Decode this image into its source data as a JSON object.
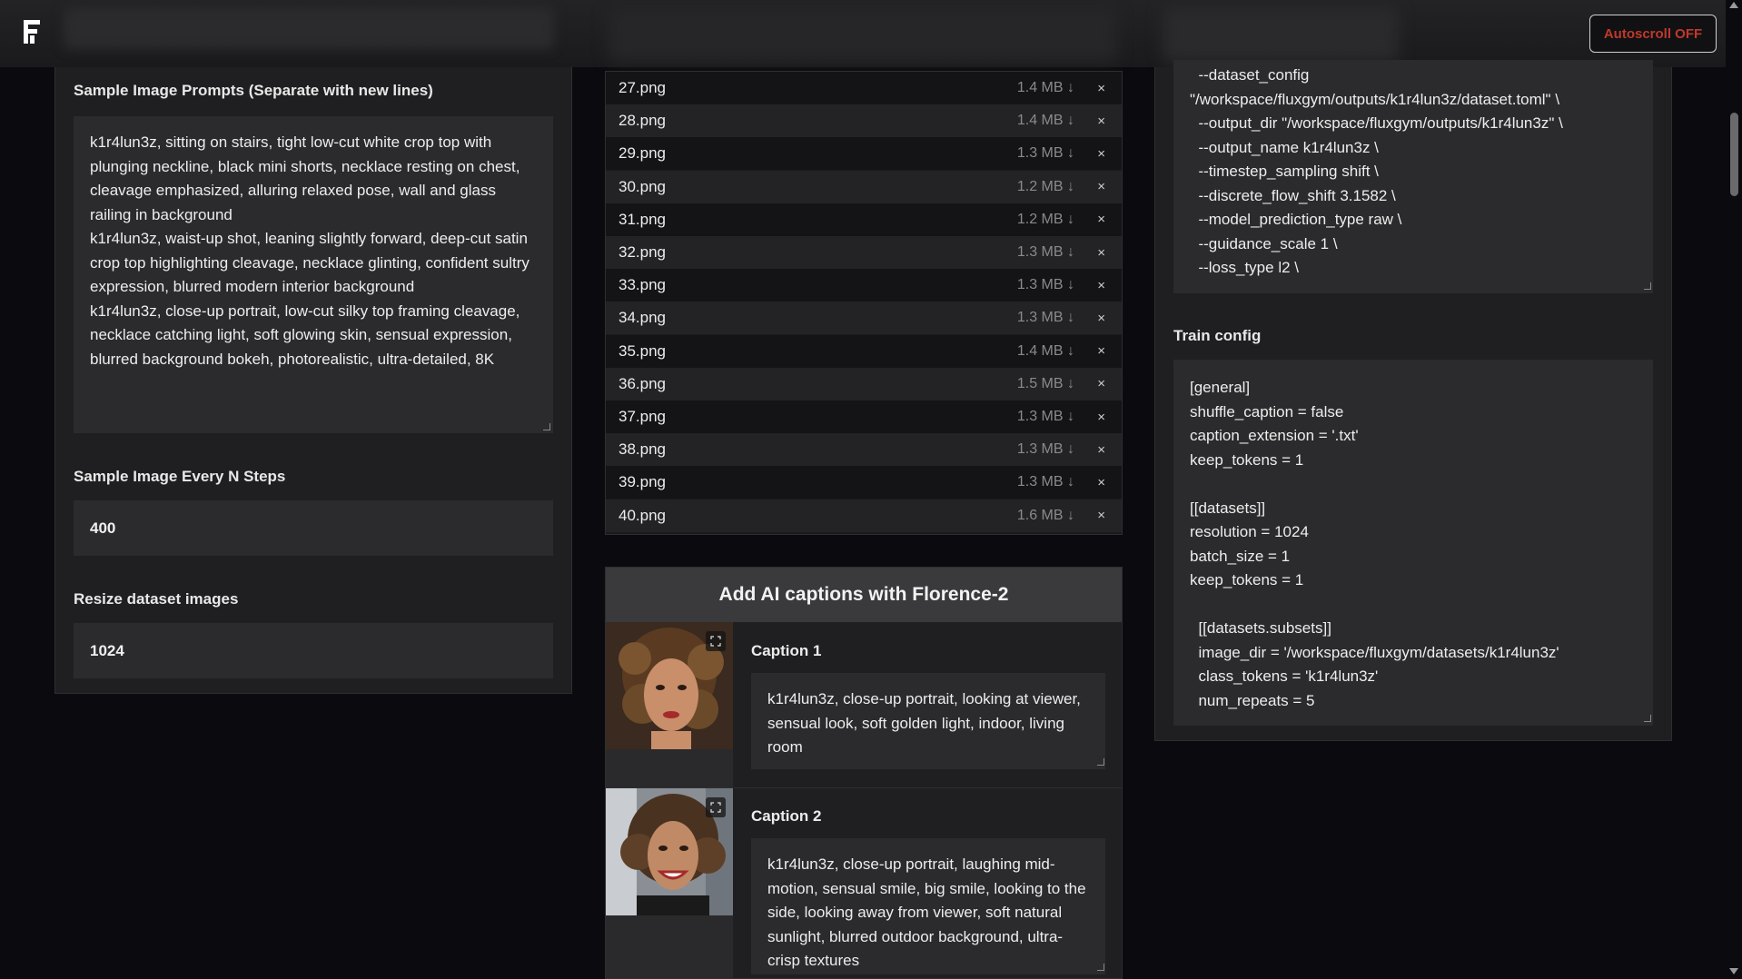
{
  "header": {
    "logo": "F",
    "autoscroll_label": "Autoscroll OFF"
  },
  "left": {
    "prompts_label": "Sample Image Prompts (Separate with new lines)",
    "prompts_value": "k1r4lun3z, sitting on stairs, tight low-cut white crop top with plunging neckline, black mini shorts, necklace resting on chest, cleavage emphasized, alluring relaxed pose, wall and glass railing in background\nk1r4lun3z, waist-up shot, leaning slightly forward, deep-cut satin crop top highlighting cleavage, necklace glinting, confident sultry expression, blurred modern interior background\nk1r4lun3z, close-up portrait, low-cut silky top framing cleavage, necklace catching light, soft glowing skin, sensual expression, blurred background bokeh, photorealistic, ultra-detailed, 8K",
    "steps_label": "Sample Image Every N Steps",
    "steps_value": "400",
    "resize_label": "Resize dataset images",
    "resize_value": "1024"
  },
  "files": [
    {
      "name": "27.png",
      "size": "1.4 MB ↓"
    },
    {
      "name": "28.png",
      "size": "1.4 MB ↓"
    },
    {
      "name": "29.png",
      "size": "1.3 MB ↓"
    },
    {
      "name": "30.png",
      "size": "1.2 MB ↓"
    },
    {
      "name": "31.png",
      "size": "1.2 MB ↓"
    },
    {
      "name": "32.png",
      "size": "1.3 MB ↓"
    },
    {
      "name": "33.png",
      "size": "1.3 MB ↓"
    },
    {
      "name": "34.png",
      "size": "1.3 MB ↓"
    },
    {
      "name": "35.png",
      "size": "1.4 MB ↓"
    },
    {
      "name": "36.png",
      "size": "1.5 MB ↓"
    },
    {
      "name": "37.png",
      "size": "1.3 MB ↓"
    },
    {
      "name": "38.png",
      "size": "1.3 MB ↓"
    },
    {
      "name": "39.png",
      "size": "1.3 MB ↓"
    },
    {
      "name": "40.png",
      "size": "1.6 MB ↓"
    }
  ],
  "remove_glyph": "×",
  "florence": {
    "button_label": "Add AI captions with Florence-2",
    "captions": [
      {
        "label": "Caption 1",
        "value": "k1r4lun3z, close-up portrait, looking at viewer, sensual look, soft golden light, indoor, living room"
      },
      {
        "label": "Caption 2",
        "value": "k1r4lun3z, close-up portrait, laughing mid-motion, sensual smile, big smile, looking to the side, looking away from viewer, soft natural sunlight, blurred outdoor background, ultra-crisp textures"
      }
    ]
  },
  "right": {
    "script_value": "  --dataset_config\n\"/workspace/fluxgym/outputs/k1r4lun3z/dataset.toml\" \\\n  --output_dir \"/workspace/fluxgym/outputs/k1r4lun3z\" \\\n  --output_name k1r4lun3z \\\n  --timestep_sampling shift \\\n  --discrete_flow_shift 3.1582 \\\n  --model_prediction_type raw \\\n  --guidance_scale 1 \\\n  --loss_type l2 \\",
    "train_label": "Train config",
    "train_value": "[general]\nshuffle_caption = false\ncaption_extension = '.txt'\nkeep_tokens = 1\n\n[[datasets]]\nresolution = 1024\nbatch_size = 1\nkeep_tokens = 1\n\n  [[datasets.subsets]]\n  image_dir = '/workspace/fluxgym/datasets/k1r4lun3z'\n  class_tokens = 'k1r4lun3z'\n  num_repeats = 5"
  },
  "colors": {
    "background": "#0b0b0f",
    "panel": "#1f1f21",
    "field": "#2b2b2d",
    "autoscroll_text": "#c0392b"
  },
  "icons": [
    "logo-icon",
    "download-icon",
    "close-icon",
    "expand-icon",
    "resize-grip-icon"
  ]
}
